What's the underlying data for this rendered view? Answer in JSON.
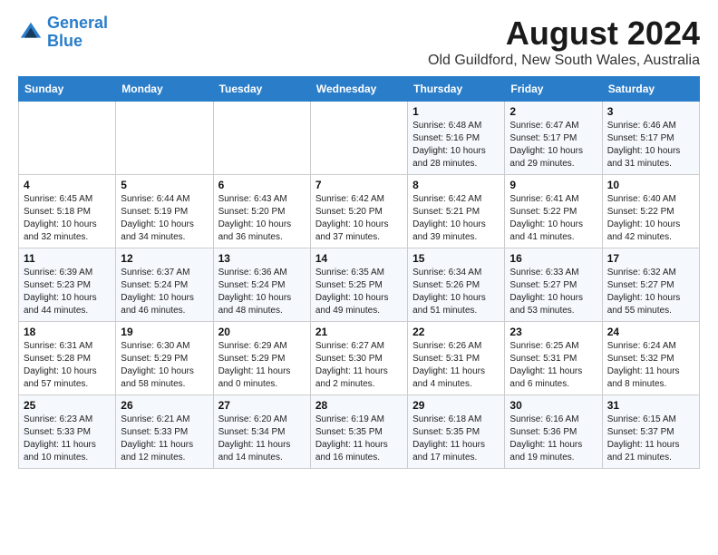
{
  "header": {
    "logo_line1": "General",
    "logo_line2": "Blue",
    "month_year": "August 2024",
    "location": "Old Guildford, New South Wales, Australia"
  },
  "weekdays": [
    "Sunday",
    "Monday",
    "Tuesday",
    "Wednesday",
    "Thursday",
    "Friday",
    "Saturday"
  ],
  "weeks": [
    [
      {
        "day": "",
        "info": ""
      },
      {
        "day": "",
        "info": ""
      },
      {
        "day": "",
        "info": ""
      },
      {
        "day": "",
        "info": ""
      },
      {
        "day": "1",
        "info": "Sunrise: 6:48 AM\nSunset: 5:16 PM\nDaylight: 10 hours\nand 28 minutes."
      },
      {
        "day": "2",
        "info": "Sunrise: 6:47 AM\nSunset: 5:17 PM\nDaylight: 10 hours\nand 29 minutes."
      },
      {
        "day": "3",
        "info": "Sunrise: 6:46 AM\nSunset: 5:17 PM\nDaylight: 10 hours\nand 31 minutes."
      }
    ],
    [
      {
        "day": "4",
        "info": "Sunrise: 6:45 AM\nSunset: 5:18 PM\nDaylight: 10 hours\nand 32 minutes."
      },
      {
        "day": "5",
        "info": "Sunrise: 6:44 AM\nSunset: 5:19 PM\nDaylight: 10 hours\nand 34 minutes."
      },
      {
        "day": "6",
        "info": "Sunrise: 6:43 AM\nSunset: 5:20 PM\nDaylight: 10 hours\nand 36 minutes."
      },
      {
        "day": "7",
        "info": "Sunrise: 6:42 AM\nSunset: 5:20 PM\nDaylight: 10 hours\nand 37 minutes."
      },
      {
        "day": "8",
        "info": "Sunrise: 6:42 AM\nSunset: 5:21 PM\nDaylight: 10 hours\nand 39 minutes."
      },
      {
        "day": "9",
        "info": "Sunrise: 6:41 AM\nSunset: 5:22 PM\nDaylight: 10 hours\nand 41 minutes."
      },
      {
        "day": "10",
        "info": "Sunrise: 6:40 AM\nSunset: 5:22 PM\nDaylight: 10 hours\nand 42 minutes."
      }
    ],
    [
      {
        "day": "11",
        "info": "Sunrise: 6:39 AM\nSunset: 5:23 PM\nDaylight: 10 hours\nand 44 minutes."
      },
      {
        "day": "12",
        "info": "Sunrise: 6:37 AM\nSunset: 5:24 PM\nDaylight: 10 hours\nand 46 minutes."
      },
      {
        "day": "13",
        "info": "Sunrise: 6:36 AM\nSunset: 5:24 PM\nDaylight: 10 hours\nand 48 minutes."
      },
      {
        "day": "14",
        "info": "Sunrise: 6:35 AM\nSunset: 5:25 PM\nDaylight: 10 hours\nand 49 minutes."
      },
      {
        "day": "15",
        "info": "Sunrise: 6:34 AM\nSunset: 5:26 PM\nDaylight: 10 hours\nand 51 minutes."
      },
      {
        "day": "16",
        "info": "Sunrise: 6:33 AM\nSunset: 5:27 PM\nDaylight: 10 hours\nand 53 minutes."
      },
      {
        "day": "17",
        "info": "Sunrise: 6:32 AM\nSunset: 5:27 PM\nDaylight: 10 hours\nand 55 minutes."
      }
    ],
    [
      {
        "day": "18",
        "info": "Sunrise: 6:31 AM\nSunset: 5:28 PM\nDaylight: 10 hours\nand 57 minutes."
      },
      {
        "day": "19",
        "info": "Sunrise: 6:30 AM\nSunset: 5:29 PM\nDaylight: 10 hours\nand 58 minutes."
      },
      {
        "day": "20",
        "info": "Sunrise: 6:29 AM\nSunset: 5:29 PM\nDaylight: 11 hours\nand 0 minutes."
      },
      {
        "day": "21",
        "info": "Sunrise: 6:27 AM\nSunset: 5:30 PM\nDaylight: 11 hours\nand 2 minutes."
      },
      {
        "day": "22",
        "info": "Sunrise: 6:26 AM\nSunset: 5:31 PM\nDaylight: 11 hours\nand 4 minutes."
      },
      {
        "day": "23",
        "info": "Sunrise: 6:25 AM\nSunset: 5:31 PM\nDaylight: 11 hours\nand 6 minutes."
      },
      {
        "day": "24",
        "info": "Sunrise: 6:24 AM\nSunset: 5:32 PM\nDaylight: 11 hours\nand 8 minutes."
      }
    ],
    [
      {
        "day": "25",
        "info": "Sunrise: 6:23 AM\nSunset: 5:33 PM\nDaylight: 11 hours\nand 10 minutes."
      },
      {
        "day": "26",
        "info": "Sunrise: 6:21 AM\nSunset: 5:33 PM\nDaylight: 11 hours\nand 12 minutes."
      },
      {
        "day": "27",
        "info": "Sunrise: 6:20 AM\nSunset: 5:34 PM\nDaylight: 11 hours\nand 14 minutes."
      },
      {
        "day": "28",
        "info": "Sunrise: 6:19 AM\nSunset: 5:35 PM\nDaylight: 11 hours\nand 16 minutes."
      },
      {
        "day": "29",
        "info": "Sunrise: 6:18 AM\nSunset: 5:35 PM\nDaylight: 11 hours\nand 17 minutes."
      },
      {
        "day": "30",
        "info": "Sunrise: 6:16 AM\nSunset: 5:36 PM\nDaylight: 11 hours\nand 19 minutes."
      },
      {
        "day": "31",
        "info": "Sunrise: 6:15 AM\nSunset: 5:37 PM\nDaylight: 11 hours\nand 21 minutes."
      }
    ]
  ]
}
